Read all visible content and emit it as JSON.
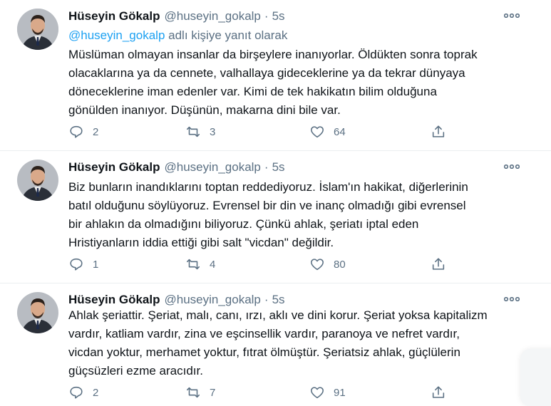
{
  "tweets": [
    {
      "author_name": "Hüseyin Gökalp",
      "handle": "@huseyin_gokalp",
      "separator": "·",
      "time": "5s",
      "reply_prefix": "@huseyin_gokalp",
      "reply_suffix": " adlı kişiye yanıt olarak",
      "text": "Müslüman olmayan insanlar da birşeylere inanıyorlar. Öldükten sonra toprak\nolacaklarına ya da cennete, valhallaya gideceklerine ya da tekrar dünyaya\ndöneceklerine iman edenler var. Kimi de tek hakikatın bilim olduğuna\ngönülden inanıyor. Düşünün, makarna dini bile var.",
      "replies": "2",
      "retweets": "3",
      "likes": "64"
    },
    {
      "author_name": "Hüseyin Gökalp",
      "handle": "@huseyin_gokalp",
      "separator": "·",
      "time": "5s",
      "text": "Biz bunların inandıklarını toptan reddediyoruz. İslam'ın hakikat, diğerlerinin\nbatıl olduğunu söylüyoruz. Evrensel bir din ve inanç olmadığı gibi evrensel\nbir ahlakın da olmadığını biliyoruz. Çünkü ahlak, şeriatı iptal eden\nHristiyanların iddia ettiği gibi salt \"vicdan\" değildir.",
      "replies": "1",
      "retweets": "4",
      "likes": "80"
    },
    {
      "author_name": "Hüseyin Gökalp",
      "handle": "@huseyin_gokalp",
      "separator": "·",
      "time": "5s",
      "text": "Ahlak şeriattir. Şeriat, malı, canı, ırzı, aklı ve dini korur. Şeriat yoksa kapitalizm\nvardır, katliam vardır, zina ve eşcinsellik vardır, paranoya ve nefret vardır,\nvicdan yoktur,   merhamet yoktur, fıtrat ölmüştür. Şeriatsiz ahlak, güçlülerin\ngüçsüzleri ezme aracıdır.",
      "replies": "2",
      "retweets": "7",
      "likes": "91"
    }
  ],
  "icons": {
    "more": "more-horizontal-icon",
    "reply": "reply-icon",
    "retweet": "retweet-icon",
    "like": "heart-icon",
    "share": "share-icon"
  },
  "colors": {
    "accent": "#1da1f2",
    "secondary_text": "#5b7083",
    "primary_text": "#0f1419"
  }
}
